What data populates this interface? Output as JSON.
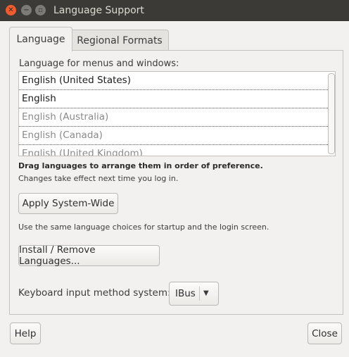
{
  "window": {
    "title": "Language Support",
    "controls": {
      "close_glyph": "✕",
      "minimize_glyph": "−",
      "maximize_glyph": "▫"
    }
  },
  "tabs": [
    {
      "label": "Language",
      "active": true
    },
    {
      "label": "Regional Formats",
      "active": false
    }
  ],
  "language_panel": {
    "menus_label": "Language for menus and windows:",
    "languages": [
      {
        "name": "English (United States)",
        "enabled": true
      },
      {
        "name": "English",
        "enabled": true
      },
      {
        "name": "English (Australia)",
        "enabled": false
      },
      {
        "name": "English (Canada)",
        "enabled": false
      },
      {
        "name": "English (United Kingdom)",
        "enabled": false
      }
    ],
    "drag_hint": "Drag languages to arrange them in order of preference.",
    "changes_hint": "Changes take effect next time you log in.",
    "apply_button": "Apply System-Wide",
    "same_choices_hint": "Use the same language choices for startup and the login screen.",
    "install_button": "Install / Remove Languages...",
    "keyboard_label": "Keyboard input method system:",
    "keyboard_value": "IBus",
    "dropdown_arrow": "▼"
  },
  "footer": {
    "help_button": "Help",
    "close_button": "Close"
  }
}
